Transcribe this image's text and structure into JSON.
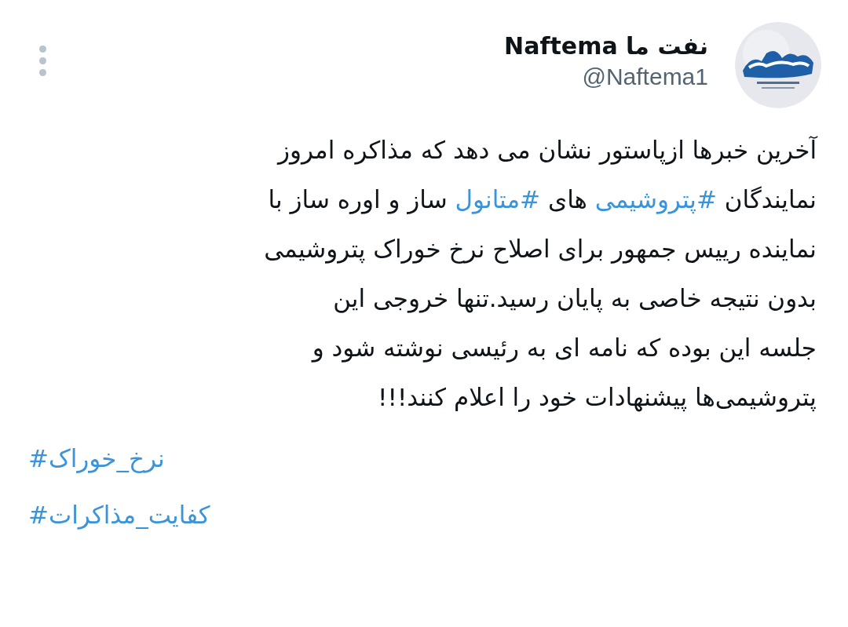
{
  "author": {
    "name": "نفت ما Naftema",
    "handle": "@Naftema1"
  },
  "body": {
    "lines": [
      [
        {
          "kind": "text",
          "text": "آخرین خبرها ازپاستور نشان می دهد که مذاکره امروز"
        }
      ],
      [
        {
          "kind": "text",
          "text": "نمایندگان "
        },
        {
          "kind": "hashtag",
          "text": "#پتروشیمی"
        },
        {
          "kind": "text",
          "text": " های "
        },
        {
          "kind": "hashtag",
          "text": "#متانول"
        },
        {
          "kind": "text",
          "text": " ساز و اوره ساز با"
        }
      ],
      [
        {
          "kind": "text",
          "text": "نماینده رییس جمهور برای اصلاح نرخ خوراک پتروشیمی"
        }
      ],
      [
        {
          "kind": "text",
          "text": "بدون نتیجه خاصی به پایان رسید.تنها خروجی این"
        }
      ],
      [
        {
          "kind": "text",
          "text": "جلسه این بوده که نامه ای به رئیسی نوشته شود و"
        }
      ],
      [
        {
          "kind": "text",
          "text": "پتروشیمی‌ها پیشنهادات خود را اعلام کنند!!!"
        }
      ]
    ]
  },
  "hashtags": [
    "#نرخ_خوراک",
    "#کفایت_مذاکرات"
  ]
}
